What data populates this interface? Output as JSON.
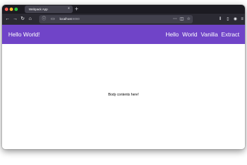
{
  "browser": {
    "tab_title": "Webpack App",
    "tab_close": "×",
    "new_tab": "+",
    "url_host": "localhost",
    "url_port": ":8080"
  },
  "app": {
    "brand": "Hello World!",
    "nav": [
      "Hello",
      "World",
      "Vanilla",
      "Extract"
    ],
    "body_text": "Body contents here!"
  },
  "colors": {
    "header": "#7044c8",
    "tabbar": "#1c1b22",
    "navbar": "#2b2a33"
  }
}
